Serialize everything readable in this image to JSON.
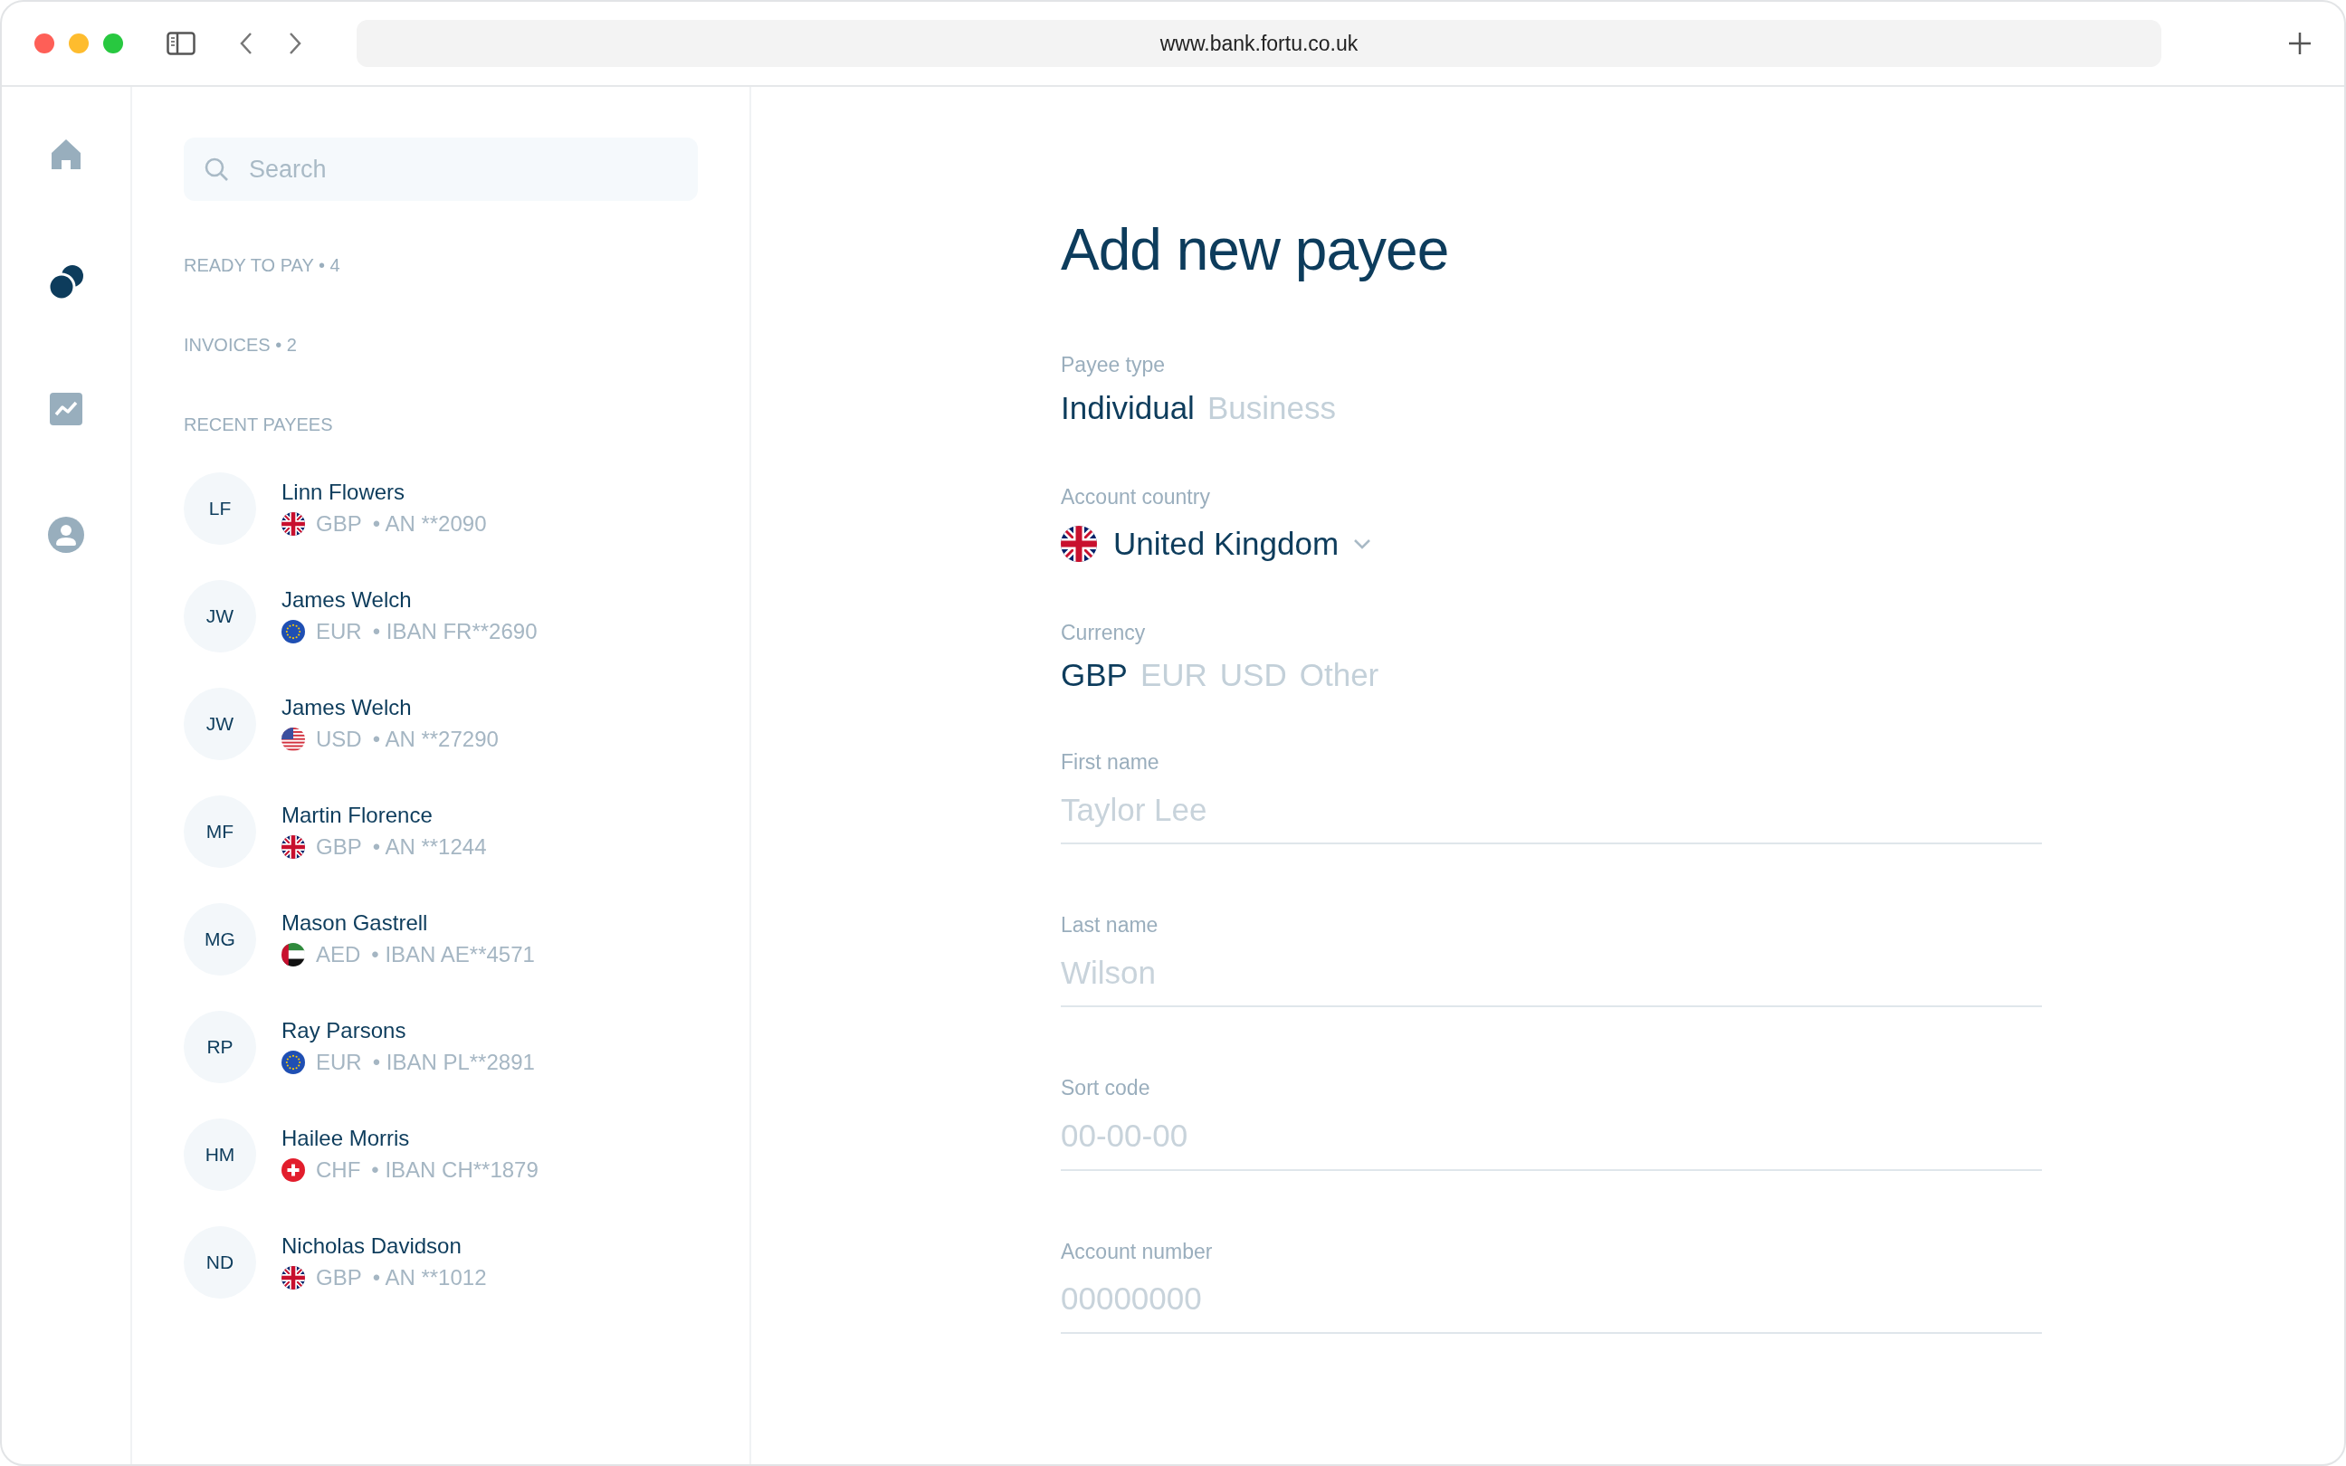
{
  "browser": {
    "url": "www.bank.fortu.co.uk"
  },
  "nav": [
    {
      "kind": "home",
      "selected": false
    },
    {
      "kind": "circles",
      "selected": true
    },
    {
      "kind": "chart",
      "selected": false
    },
    {
      "kind": "user",
      "selected": false
    }
  ],
  "search": {
    "placeholder": "Search"
  },
  "sections": [
    "READY TO PAY • 4",
    "INVOICES • 2"
  ],
  "recent_payees": {
    "title": "RECENT PAYEES",
    "items": [
      {
        "initials": "LF",
        "name": "Linn Flowers",
        "kind": "gb",
        "currency": "GBP",
        "account": "• AN **2090"
      },
      {
        "initials": "JW",
        "name": "James Welch",
        "kind": "eu",
        "currency": "EUR",
        "account": "• IBAN FR**2690"
      },
      {
        "initials": "JW",
        "name": "James Welch",
        "kind": "us",
        "currency": "USD",
        "account": "• AN **27290"
      },
      {
        "initials": "MF",
        "name": "Martin Florence",
        "kind": "gb",
        "currency": "GBP",
        "account": "• AN **1244"
      },
      {
        "initials": "MG",
        "name": "Mason Gastrell",
        "kind": "ae",
        "currency": "AED",
        "account": "• IBAN AE**4571"
      },
      {
        "initials": "RP",
        "name": "Ray Parsons",
        "kind": "eu",
        "currency": "EUR",
        "account": "• IBAN PL**2891"
      },
      {
        "initials": "HM",
        "name": "Hailee Morris",
        "kind": "ch",
        "currency": "CHF",
        "account": "• IBAN CH**1879"
      },
      {
        "initials": "ND",
        "name": "Nicholas Davidson",
        "kind": "gb",
        "currency": "GBP",
        "account": "• AN **1012"
      }
    ]
  },
  "form": {
    "title": "Add new payee",
    "payee_type": {
      "label": "Payee type",
      "options": [
        {
          "label": "Individual",
          "selected": true
        },
        {
          "label": "Business",
          "selected": false
        }
      ]
    },
    "account_country": {
      "label": "Account country",
      "kind": "gb",
      "value": "United Kingdom"
    },
    "currency": {
      "label": "Currency",
      "options": [
        {
          "label": "GBP",
          "selected": true
        },
        {
          "label": "EUR",
          "selected": false
        },
        {
          "label": "USD",
          "selected": false
        },
        {
          "label": "Other",
          "selected": false
        }
      ]
    },
    "fields": [
      {
        "label": "First name",
        "placeholder": "Taylor Lee"
      },
      {
        "label": "Last name",
        "placeholder": "Wilson"
      },
      {
        "label": "Sort code",
        "placeholder": "00-00-00"
      },
      {
        "label": "Account number",
        "placeholder": "00000000"
      }
    ]
  }
}
